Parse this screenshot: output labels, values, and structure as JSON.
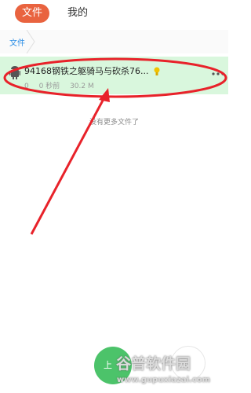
{
  "tabs": [
    {
      "label": "文件",
      "active": true
    },
    {
      "label": "我的",
      "active": false
    }
  ],
  "breadcrumb": {
    "label": "文件"
  },
  "file": {
    "name": "94168钢铁之躯骑马与砍杀76...",
    "count": "0",
    "time": "0 秒前",
    "size": "30.2 M",
    "icon": "android-icon"
  },
  "empty_message": "没有更多文件了",
  "fab": {
    "label": "上"
  },
  "watermark": {
    "brand": "谷普软件园",
    "url": "www.gupuxiazai.com"
  },
  "colors": {
    "accent": "#e9633f",
    "highlight_row": "#d9f7dd",
    "annotation": "#e8222a",
    "fab": "#4cc36a"
  }
}
